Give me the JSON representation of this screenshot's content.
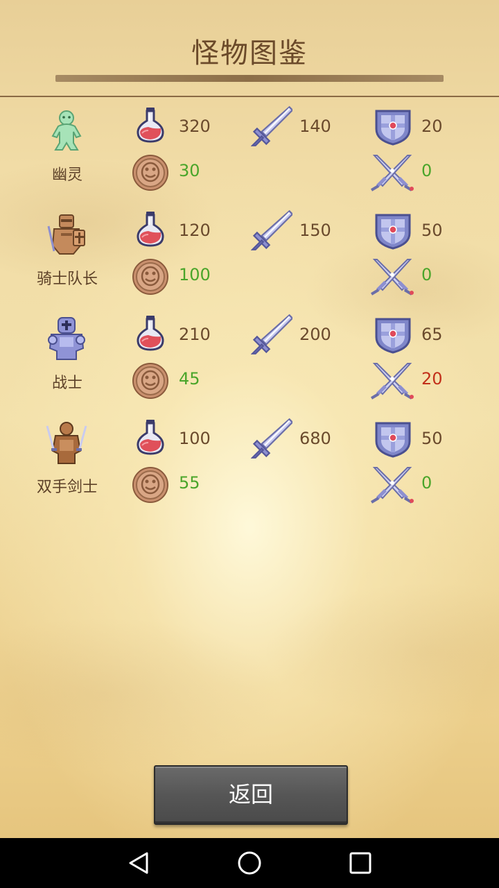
{
  "title": "怪物图鉴",
  "back_button": "返回",
  "monsters": [
    {
      "name": "幽灵",
      "sprite": "ghost-icon",
      "hp": "320",
      "atk": "140",
      "def": "20",
      "gold": "30",
      "damage": "0",
      "damage_color": "green"
    },
    {
      "name": "骑士队长",
      "sprite": "knight-captain-icon",
      "hp": "120",
      "atk": "150",
      "def": "50",
      "gold": "100",
      "damage": "0",
      "damage_color": "green"
    },
    {
      "name": "战士",
      "sprite": "warrior-icon",
      "hp": "210",
      "atk": "200",
      "def": "65",
      "gold": "45",
      "damage": "20",
      "damage_color": "red"
    },
    {
      "name": "双手剑士",
      "sprite": "dual-swordsman-icon",
      "hp": "100",
      "atk": "680",
      "def": "50",
      "gold": "55",
      "damage": "0",
      "damage_color": "green"
    }
  ],
  "stat_icons": [
    "potion-icon",
    "sword-icon",
    "shield-icon",
    "coin-icon",
    "crossed-swords-icon"
  ],
  "colors": {
    "green": "#4aa52a",
    "red": "#c2301a",
    "text": "#6a4a2c",
    "button": "#555555"
  },
  "nav": [
    "back-nav-icon",
    "home-nav-icon",
    "recents-nav-icon"
  ]
}
